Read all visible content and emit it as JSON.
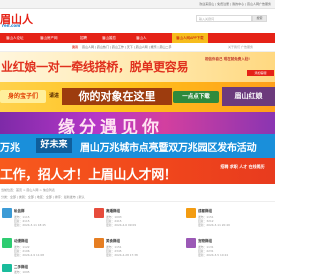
{
  "topbar": {
    "links": "欢迎来眉山 | 免费注册 | 我的中心 | 眉山人网广告服务"
  },
  "logo": {
    "cn": "眉山人",
    "en": "ren.com"
  },
  "search": {
    "placeholder": "输入关键词",
    "button": "搜索"
  },
  "nav": {
    "items": [
      "眉山人论坛",
      "眉山房产网",
      "招聘",
      "眉山婚恋",
      "眉山人",
      "眉山人网APP下载"
    ]
  },
  "subnav": {
    "row1_label": "资讯",
    "row1": "眉山人网 | 眉山热门 | 眉山工作 | 天下 | 眉山人网 | 娱乐 | 眉山二手",
    "row2_label": "服务",
    "row2": "房产中介 | 眉山搬家 | 眉山小吃 | 婚庆 | 眉山找店 | 眉山停车",
    "badge": "关于我们 广告服务"
  },
  "banner1": {
    "text": "业红娘一对一牵线搭桥，脱单更容易",
    "side": "相信你自己 现在就免费入驻!",
    "tag": "添加客服"
  },
  "banner2": {
    "left": "身的宝子们",
    "please": "请进",
    "main": "你的对象在这里",
    "button": "一点点下载",
    "logo": "眉山红娘"
  },
  "banner3": {
    "text": "缘分遇见你"
  },
  "banner4": {
    "left": "万兆",
    "brand": "好未来",
    "main": "眉山万兆城市点亮暨双万兆园区发布活动"
  },
  "banner5": {
    "text": "工作，招人才！上眉山人才网！",
    "side": "招聘 求职 人才 在线简历"
  },
  "breadcrumb": "当前位置：首页 > 眉山人网 > 信息列表",
  "filter": "分类：全部 | 类别：全部 | 地区：全部 | 排序：最新发布 | 默认",
  "cards": [
    {
      "title": "私信群",
      "l1": "发布：1115",
      "l2": "回复：4115",
      "l3": "更新：2024-3-11 18:45",
      "color": "#3c9bd6"
    },
    {
      "title": "离婚群组",
      "l1": "发布：1093",
      "l2": "回复：2415",
      "l3": "更新：2024-4-6 09:09",
      "color": "#e74c3c"
    },
    {
      "title": "成都群组",
      "l1": "发布：1151",
      "l2": "回复：3212",
      "l3": "更新：2024-3-11 20:49",
      "color": "#f39c12"
    },
    {
      "title": "动漫群组",
      "l1": "发布：1122",
      "l2": "回复：2106",
      "l3": "更新：2024-2-9 11:08",
      "color": "#2ecc71"
    },
    {
      "title": "美食群组",
      "l1": "发布：1151",
      "l2": "回复：2345",
      "l3": "更新：2024-4-28 17:38",
      "color": "#e67e22"
    },
    {
      "title": "宠物群组",
      "l1": "发布：1131",
      "l2": "回复：2231",
      "l3": "更新：2024-3-5 10:24",
      "color": "#9b59b6"
    },
    {
      "title": "二手群组",
      "l1": "发布：1095",
      "l2": "回复：1987",
      "l3": "更新：2024-4-6 11:29",
      "color": "#1abc9c"
    }
  ]
}
